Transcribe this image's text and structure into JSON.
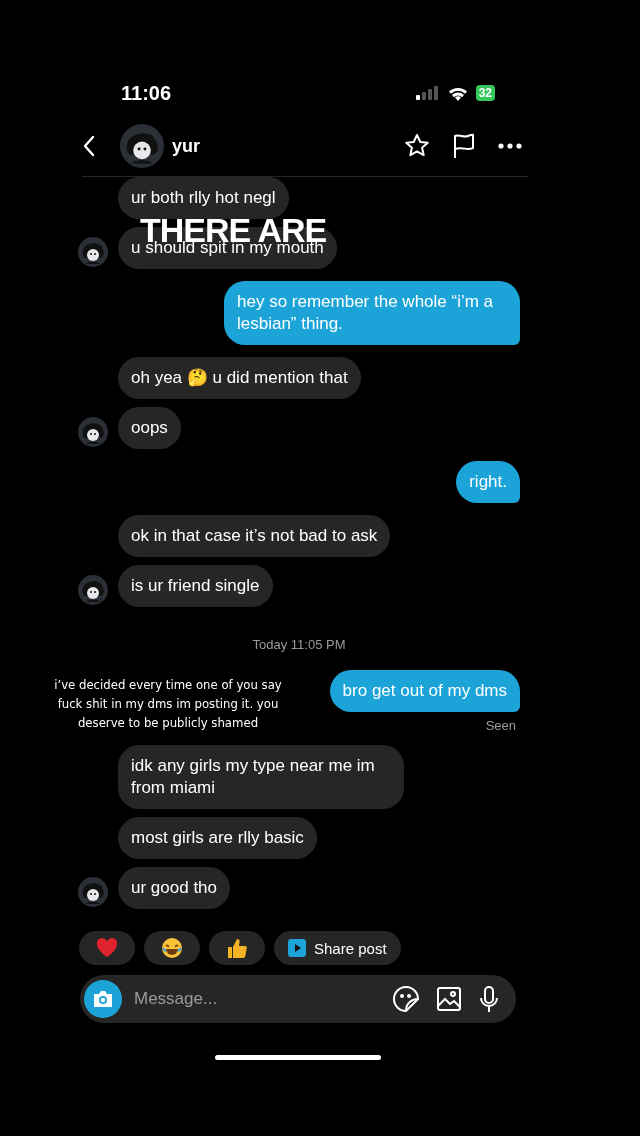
{
  "status_bar": {
    "time": "11:06",
    "battery": "32"
  },
  "header": {
    "username": "yur"
  },
  "messages": [
    {
      "kind": "received",
      "text": "ur both rlly hot negl",
      "avatar": false
    },
    {
      "kind": "received",
      "text": "u should spit in my mouth",
      "avatar": true
    },
    {
      "kind": "sent",
      "text": "hey so remember the whole “i’m a lesbian” thing."
    },
    {
      "kind": "received",
      "text": "oh yea 🤔 u did mention that",
      "avatar": false
    },
    {
      "kind": "received",
      "text": "oops",
      "avatar": true
    },
    {
      "kind": "sent",
      "text": "right."
    },
    {
      "kind": "received",
      "text": "ok in that case it’s not bad to ask",
      "avatar": false
    },
    {
      "kind": "received",
      "text": "is ur friend single",
      "avatar": true
    },
    {
      "kind": "timestamp",
      "text": "Today 11:05 PM"
    },
    {
      "kind": "sent",
      "text": "bro get out of my dms"
    },
    {
      "kind": "seen",
      "text": "Seen"
    },
    {
      "kind": "received",
      "text": "idk any girls my type near me im from miami",
      "avatar": false
    },
    {
      "kind": "received",
      "text": "most girls are rlly basic",
      "avatar": false
    },
    {
      "kind": "received",
      "text": "ur good tho",
      "avatar": true
    }
  ],
  "quick_replies": [
    {
      "kind": "heart"
    },
    {
      "kind": "laugh"
    },
    {
      "kind": "thumbs"
    },
    {
      "kind": "share",
      "label": "Share post"
    }
  ],
  "composer": {
    "placeholder": "Message..."
  },
  "overlays": [
    {
      "kind": "headline",
      "text": "THERE ARE"
    },
    {
      "kind": "caption",
      "text": "i’ve decided every time one of you say fuck shit in my dms im posting it. you deserve to be publicly shamed"
    }
  ]
}
